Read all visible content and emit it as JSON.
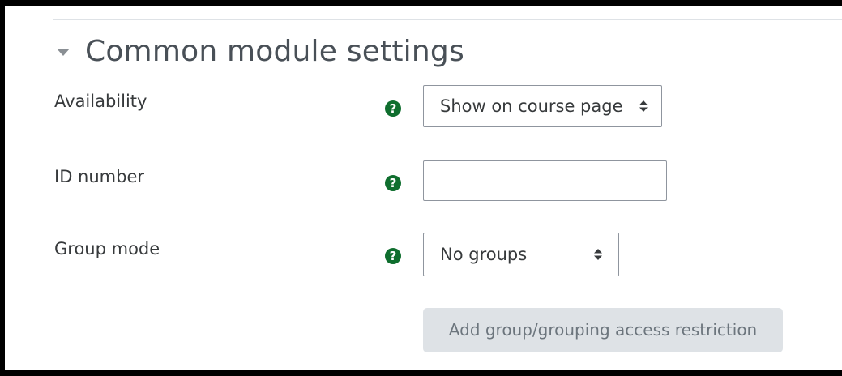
{
  "section": {
    "title": "Common module settings"
  },
  "fields": {
    "availability": {
      "label": "Availability",
      "help": "?",
      "selected": "Show on course page"
    },
    "id_number": {
      "label": "ID number",
      "help": "?",
      "value": ""
    },
    "group_mode": {
      "label": "Group mode",
      "help": "?",
      "selected": "No groups"
    }
  },
  "actions": {
    "add_restriction_label": "Add group/grouping access restriction"
  },
  "colors": {
    "help_icon": "#0f6e2e",
    "button_bg": "#dee2e6",
    "button_text": "#6c757d",
    "title_text": "#495057"
  },
  "icons": {
    "collapse": "caret-down-icon",
    "help": "question-circle-icon",
    "select": "sort-arrows-icon"
  }
}
